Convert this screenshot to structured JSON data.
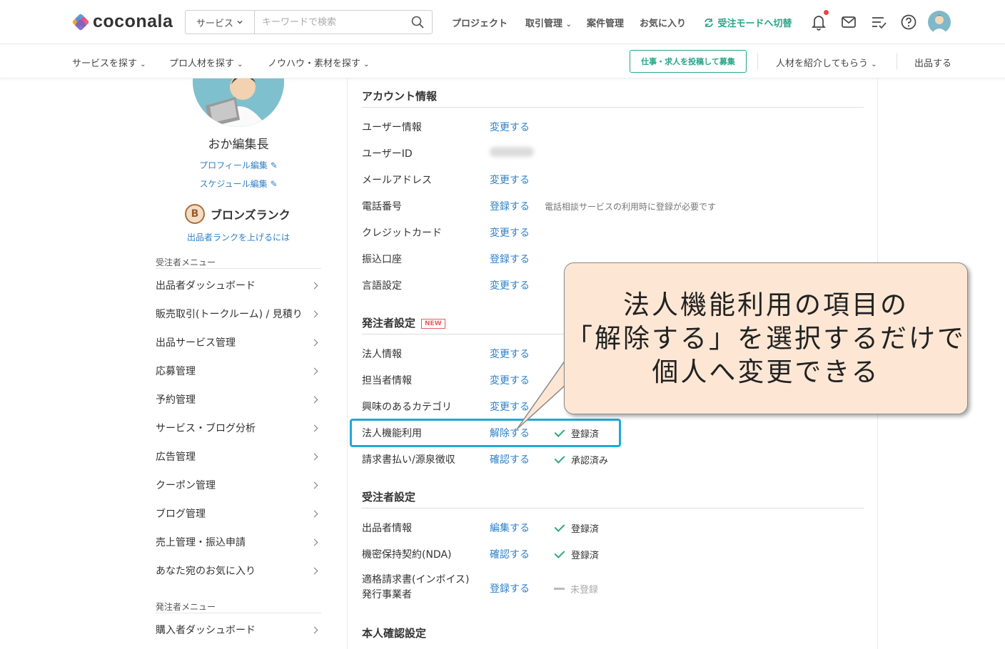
{
  "header": {
    "logo_text": "coconala",
    "search_select": "サービス",
    "search_placeholder": "キーワードで検索",
    "nav": {
      "project": "プロジェクト",
      "transactions": "取引管理",
      "cases": "案件管理",
      "favorites": "お気に入り",
      "mode_switch": "受注モードへ切替"
    },
    "icons": [
      "bell-icon",
      "mail-icon",
      "task-list-icon",
      "help-icon"
    ],
    "accent_color": "#29a587"
  },
  "subnav": {
    "find_service": "サービスを探す",
    "find_pro": "プロ人材を探す",
    "knowhow": "ノウハウ・素材を探す",
    "post_job": "仕事・求人を投稿して募集",
    "introduce": "人材を紹介してもらう",
    "sell": "出品する"
  },
  "sidebar": {
    "user_name": "おか編集長",
    "profile_edit": "プロフィール編集",
    "schedule_edit": "スケジュール編集",
    "rank_letter": "B",
    "rank_label": "ブロンズランク",
    "rank_link": "出品者ランクを上げるには",
    "seller_menu_title": "受注者メニュー",
    "seller_menu": [
      "出品者ダッシュボード",
      "販売取引(トークルーム) / 見積り",
      "出品サービス管理",
      "応募管理",
      "予約管理",
      "サービス・ブログ分析",
      "広告管理",
      "クーポン管理",
      "ブログ管理",
      "売上管理・振込申請",
      "あなた宛のお気に入り"
    ],
    "buyer_menu_title": "発注者メニュー",
    "buyer_menu": [
      "購入者ダッシュボード"
    ]
  },
  "account": {
    "title": "アカウント情報",
    "rows": [
      {
        "label": "ユーザー情報",
        "action": "変更する"
      },
      {
        "label": "ユーザーID",
        "action": ""
      },
      {
        "label": "メールアドレス",
        "action": "変更する"
      },
      {
        "label": "電話番号",
        "action": "登録する",
        "note": "電話相談サービスの利用時に登録が必要です"
      },
      {
        "label": "クレジットカード",
        "action": "変更する"
      },
      {
        "label": "振込口座",
        "action": "登録する"
      },
      {
        "label": "言語設定",
        "action": "変更する"
      }
    ]
  },
  "buyer_settings": {
    "title": "発注者設定",
    "badge": "NEW",
    "rows": [
      {
        "label": "法人情報",
        "action": "変更する"
      },
      {
        "label": "担当者情報",
        "action": "変更する"
      },
      {
        "label": "興味のあるカテゴリ",
        "action": "変更する"
      },
      {
        "label": "法人機能利用",
        "action": "解除する",
        "status": "登録済"
      },
      {
        "label": "請求書払い/源泉徴収",
        "action": "確認する",
        "status": "承認済み"
      }
    ]
  },
  "seller_settings": {
    "title": "受注者設定",
    "rows": [
      {
        "label": "出品者情報",
        "action": "編集する",
        "status": "登録済"
      },
      {
        "label": "機密保持契約(NDA)",
        "action": "確認する",
        "status": "登録済"
      },
      {
        "label_line1": "適格請求書(インボイス)",
        "label_line2": "発行事業者",
        "action": "登録する",
        "status": "未登録"
      }
    ]
  },
  "identity": {
    "title": "本人確認設定"
  },
  "callout": {
    "line1": "法人機能利用の項目の",
    "line2": "「解除する」を選択するだけで",
    "line3": "個人へ変更できる",
    "bg_color": "#fde7d4",
    "highlight_color": "#1fa9d9"
  }
}
